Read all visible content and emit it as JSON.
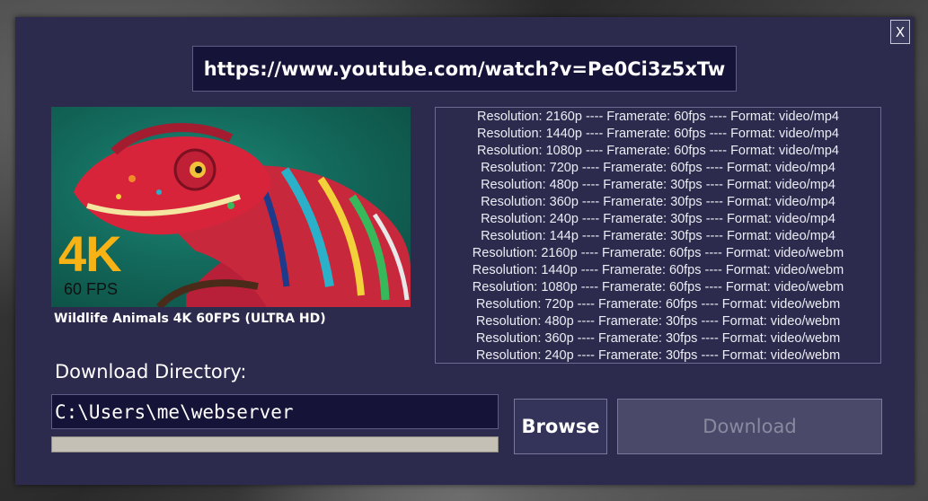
{
  "window": {
    "close_label": "X"
  },
  "url": {
    "value": "https://www.youtube.com/watch?v=Pe0Ci3z5xTw"
  },
  "thumbnail": {
    "badge_resolution": "4K",
    "badge_fps": "60 FPS"
  },
  "video": {
    "title": "Wildlife Animals 4K 60FPS (ULTRA HD)"
  },
  "formats": [
    "Resolution: 2160p ---- Framerate: 60fps ---- Format: video/mp4",
    "Resolution: 1440p ---- Framerate: 60fps ---- Format: video/mp4",
    "Resolution: 1080p ---- Framerate: 60fps ---- Format: video/mp4",
    "Resolution: 720p ---- Framerate: 60fps ---- Format: video/mp4",
    "Resolution: 480p ---- Framerate: 30fps ---- Format: video/mp4",
    "Resolution: 360p ---- Framerate: 30fps ---- Format: video/mp4",
    "Resolution: 240p ---- Framerate: 30fps ---- Format: video/mp4",
    "Resolution: 144p ---- Framerate: 30fps ---- Format: video/mp4",
    "Resolution: 2160p ---- Framerate: 60fps ---- Format: video/webm",
    "Resolution: 1440p ---- Framerate: 60fps ---- Format: video/webm",
    "Resolution: 1080p ---- Framerate: 60fps ---- Format: video/webm",
    "Resolution: 720p ---- Framerate: 60fps ---- Format: video/webm",
    "Resolution: 480p ---- Framerate: 30fps ---- Format: video/webm",
    "Resolution: 360p ---- Framerate: 30fps ---- Format: video/webm",
    "Resolution: 240p ---- Framerate: 30fps ---- Format: video/webm"
  ],
  "download": {
    "directory_label": "Download Directory:",
    "directory_value": "C:\\Users\\me\\webserver",
    "progress": 0,
    "browse_label": "Browse",
    "download_label": "Download"
  },
  "colors": {
    "window_bg": "#2c2b4d",
    "input_bg": "#151338",
    "progress_track": "#c4c0b6",
    "download_disabled_text": "#8a899f"
  }
}
